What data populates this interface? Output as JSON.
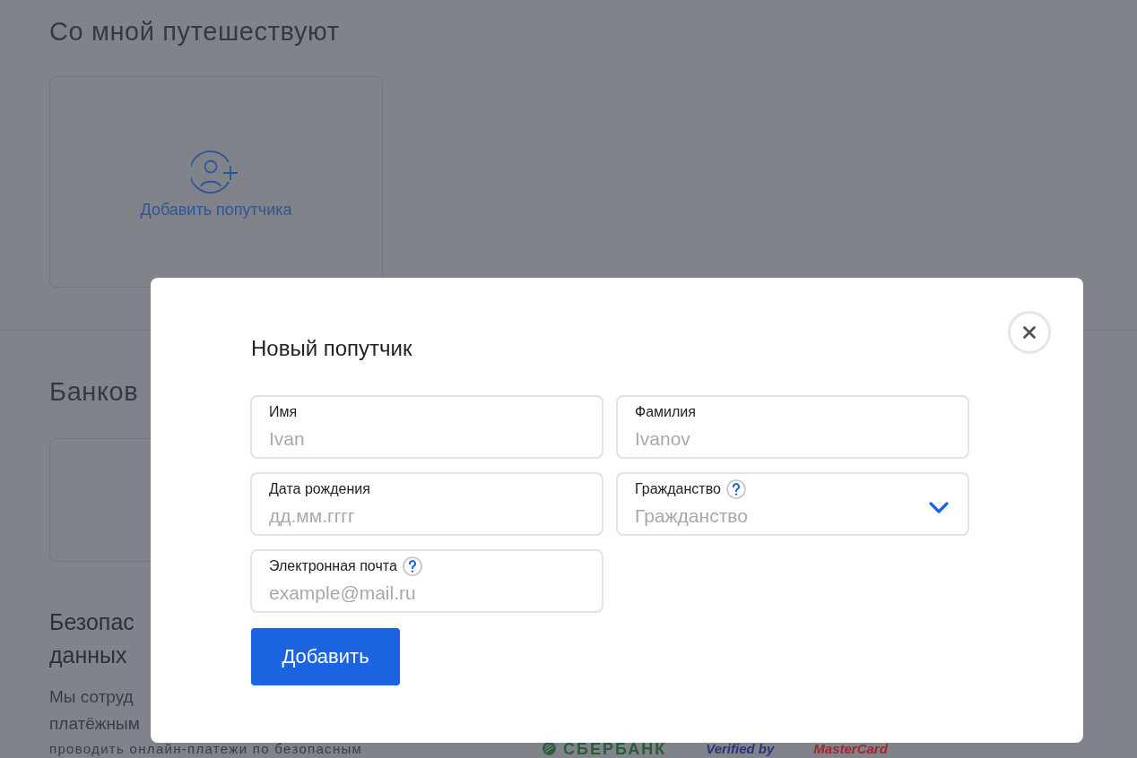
{
  "companions": {
    "title": "Со мной путешествуют",
    "add_card": {
      "label": "Добавить попутчика"
    }
  },
  "bank_cards": {
    "title": "Банков"
  },
  "security": {
    "title_lines": [
      "Безопас",
      "данных"
    ],
    "text_lines": [
      "Мы сотруд",
      "платёжным",
      "проводить онлайн-платежи по безопасным"
    ],
    "logos": [
      {
        "kind": "sberbank",
        "text": "СБЕРБАНК"
      },
      {
        "kind": "visa",
        "text": "Verified by"
      },
      {
        "kind": "mastercard",
        "text": "MasterCard"
      }
    ]
  },
  "dialog": {
    "title": "Новый попутчик",
    "fields": [
      {
        "label": "Имя",
        "placeholder": "Ivan",
        "kind": "text",
        "help": false
      },
      {
        "label": "Фамилия",
        "placeholder": "Ivanov",
        "kind": "text",
        "help": false
      },
      {
        "label": "Дата рождения",
        "placeholder": "дд.мм.гггг",
        "kind": "text",
        "help": false
      },
      {
        "label": "Гражданство",
        "placeholder": "Гражданство",
        "kind": "select",
        "help": true
      },
      {
        "label": "Электронная почта",
        "placeholder": "example@mail.ru",
        "kind": "text",
        "help": true
      }
    ],
    "submit": "Добавить"
  }
}
